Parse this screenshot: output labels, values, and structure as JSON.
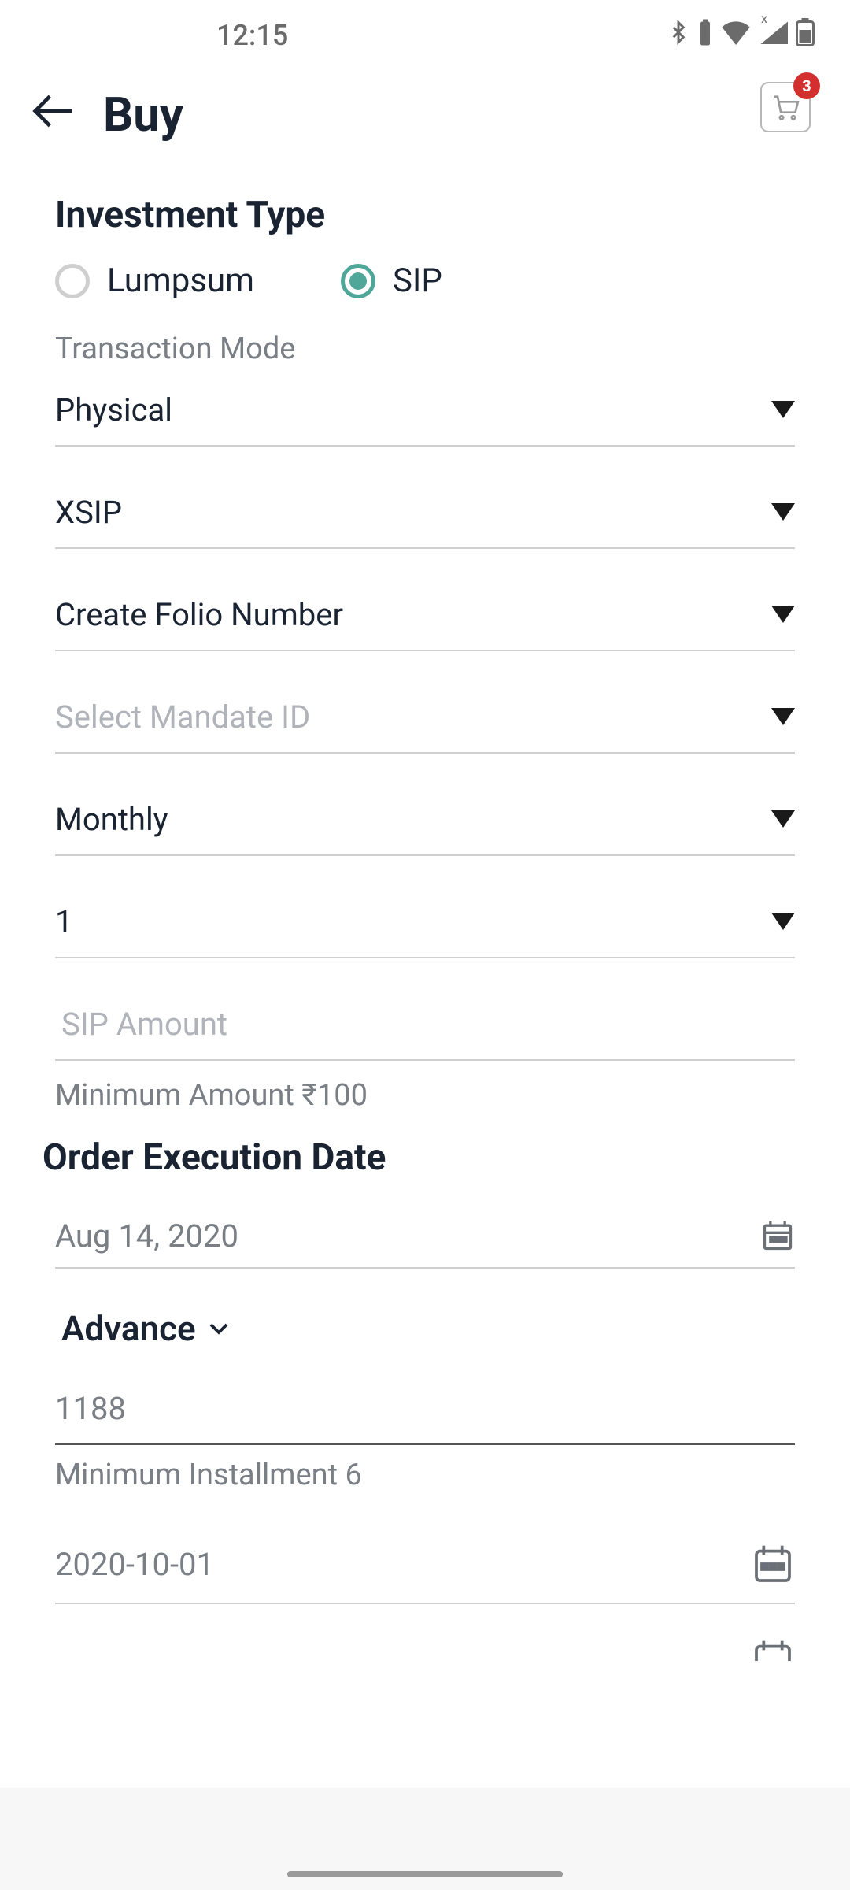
{
  "status": {
    "time": "12:15"
  },
  "header": {
    "title": "Buy",
    "cart_count": "3"
  },
  "investment": {
    "type_heading": "Investment Type",
    "radio_lumpsum": "Lumpsum",
    "radio_sip": "SIP",
    "selected": "sip",
    "transaction_mode_label": "Transaction Mode",
    "transaction_mode_value": "Physical",
    "sip_type_value": "XSIP",
    "folio_value": "Create Folio Number",
    "mandate_placeholder": "Select Mandate ID",
    "frequency_value": "Monthly",
    "day_value": "1",
    "sip_amount_placeholder": "SIP Amount",
    "min_amount_text": "Minimum Amount ₹100"
  },
  "order": {
    "execution_heading": "Order Execution Date",
    "execution_date": "Aug 14, 2020",
    "advance_label": "Advance",
    "installments_value": "1188",
    "min_installment_text": "Minimum Installment 6",
    "start_date": "2020-10-01"
  }
}
